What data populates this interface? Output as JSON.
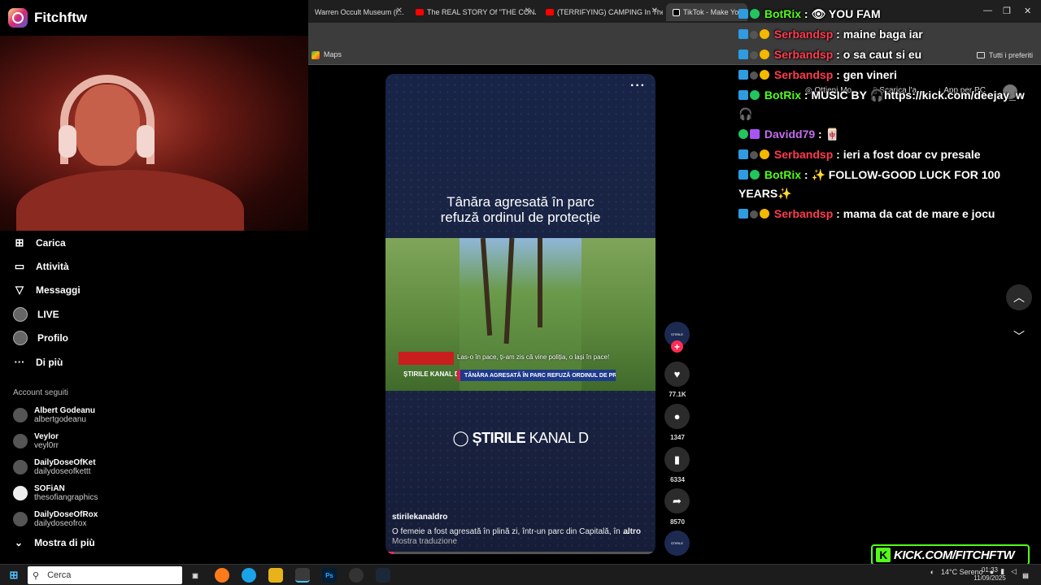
{
  "overlay": {
    "brand_name": "Fitchftw",
    "kick_url": "KICK.COM/FITCHFTW"
  },
  "browser": {
    "tabs": [
      {
        "title": "Warren Occult Museum (I..."
      },
      {
        "title": "The REAL STORY Of \"THE CONJ"
      },
      {
        "title": "(TERRIFYING) CAMPING In The"
      },
      {
        "title": "TikTok - Make Your Day"
      }
    ],
    "bookmarks": {
      "maps": "Maps",
      "all_favorites": "Tutti i preferiti"
    },
    "toolbar": {
      "get_app": "Ottieni Mo",
      "download": "Scarica l'a...",
      "app_pc": "App per PC"
    }
  },
  "sidebar": {
    "items": [
      {
        "label": "Carica",
        "icon": "upload-icon"
      },
      {
        "label": "Attività",
        "icon": "activity-icon"
      },
      {
        "label": "Messaggi",
        "icon": "messages-icon"
      },
      {
        "label": "LIVE",
        "icon": "live-avatar"
      },
      {
        "label": "Profilo",
        "icon": "profile-avatar"
      },
      {
        "label": "Di più",
        "icon": "more-icon"
      }
    ],
    "following_title": "Account seguiti",
    "accounts": [
      {
        "name": "Albert Godeanu",
        "handle": "albertgodeanu"
      },
      {
        "name": "Veylor",
        "handle": "veyl0rr"
      },
      {
        "name": "DailyDoseOfKet",
        "handle": "dailydoseofkettt"
      },
      {
        "name": "SOFiAN",
        "handle": "thesofiangraphics"
      },
      {
        "name": "DailyDoseOfRox",
        "handle": "dailydoseofrox"
      }
    ],
    "show_more": "Mostra di più"
  },
  "video": {
    "headline_line1": "Tânăra agresată în parc",
    "headline_line2": "refuză ordinul de protecție",
    "subtitle": "Las-o în pace, ți-am zis că vine poliția, o lași în pace!",
    "lower_third": "TÂNĂRA AGRESATĂ ÎN PARC REFUZĂ ORDINUL DE PROTECȚIE",
    "small_logo": "ȘTIRILE KANAL D",
    "channel_logo_bold": "ȘTIRILE",
    "channel_logo_rest": " KANAL D",
    "author": "stirilekanaldro",
    "description": "O femeie a fost agresată în plină zi, într-un parc din Capitală, în ...",
    "more": "altro",
    "translate": "Mostra traduzione",
    "progress": 0.03
  },
  "actions": {
    "likes": "77.1K",
    "comments": "1347",
    "saves": "6334",
    "shares": "8570"
  },
  "chat": [
    {
      "user": "BotRix",
      "color": "green",
      "text": "YOU FAM",
      "emote": "👁"
    },
    {
      "user": "Serbandsp",
      "color": "red",
      "text": "maine baga iar"
    },
    {
      "user": "Serbandsp",
      "color": "red",
      "text": "o sa caut si eu"
    },
    {
      "user": "Serbandsp",
      "color": "red",
      "text": "gen vineri"
    },
    {
      "user": "BotRix",
      "color": "green",
      "text": "MUSIC BY 🎧https://kick.com/deejay_w 🎧"
    },
    {
      "user": "Davidd79",
      "color": "purple",
      "text": "🀄"
    },
    {
      "user": "Serbandsp",
      "color": "red",
      "text": "ieri a fost doar cv presale"
    },
    {
      "user": "BotRix",
      "color": "green",
      "text": "✨ FOLLOW-GOOD LUCK FOR 100 YEARS✨"
    },
    {
      "user": "Serbandsp",
      "color": "red",
      "text": "mama da cat de mare e jocu"
    }
  ],
  "taskbar": {
    "search_placeholder": "Cerca",
    "weather": "14°C  Sereno",
    "time": "01:33",
    "date": "11/09/2025"
  }
}
